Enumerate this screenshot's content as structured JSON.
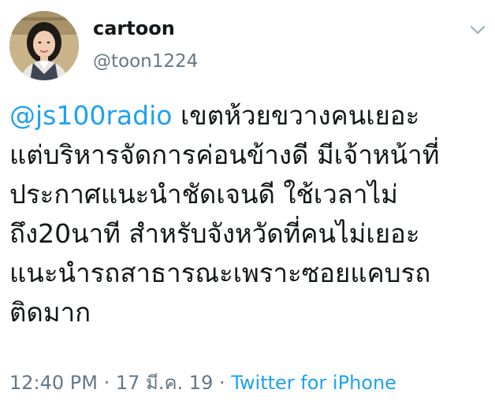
{
  "user": {
    "display_name": "cartoon",
    "username": "@toon1224"
  },
  "tweet": {
    "mention": "@js100radio",
    "lines": [
      " เขตห้วยขวางคนเยอะ",
      "แต่บริหารจัดการค่อนข้างดี มีเจ้าหน้าที่",
      "ประกาศแนะนำชัดเจนดี ใช้เวลาไม่",
      "ถึง20นาที สำหรับจังหวัดที่คนไม่เยอะ",
      "แนะนำรถสาธารณะเพราะซอยแคบรถ",
      "ติดมาก"
    ]
  },
  "meta": {
    "time": "12:40 PM",
    "separator1": " · ",
    "date": "17 มี.ค. 19",
    "separator2": " · ",
    "source": "Twitter for iPhone"
  },
  "icons": {
    "menu": "chevron-down-icon"
  },
  "colors": {
    "link": "#1da1f2",
    "secondary_text": "#657786",
    "primary_text": "#14171a"
  }
}
